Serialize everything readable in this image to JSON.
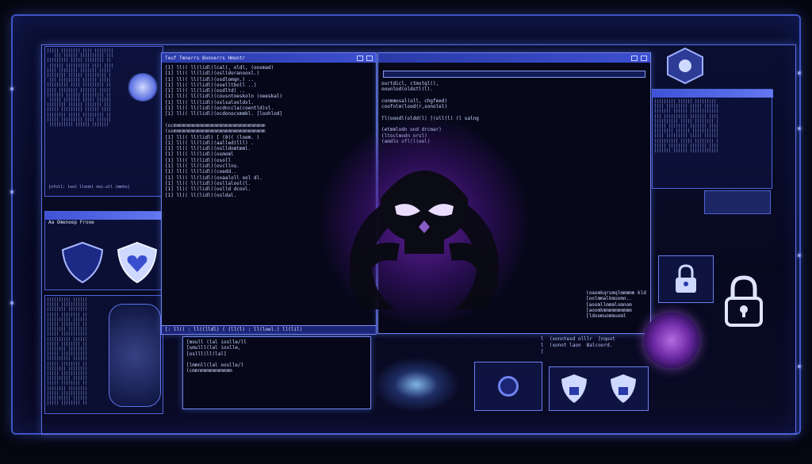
{
  "colors": {
    "accent": "#5a70e0",
    "glow_purple": "#a43bff",
    "panel": "#0b1033"
  },
  "main_terminal": {
    "title": "Teuf Tmnerrs Bonnerrs Hmontr",
    "lines": [
      "[1] ll(( ll(lidl)lcal(, oldl, (ooxmad)",
      "[1] ll(( ll(lidl)(oslldoranooxl.)",
      "[1] ll(( ll(lidl)(osdlomqn.) ..",
      "[1] ll(( ll(lidl)(oselltboll ..)",
      "[1] ll(( ll(lidl)(osdltd) ..",
      "[1] ll(( ll(lidl)(cousntoeskoln (oeeskal)",
      "[1] ll(( ll(lidl)(oxlsalooldxl.",
      "[1] ll(( ll(lidl)(ocdnccla(coentld)xl.",
      "[1] ll(( ll(lidl)(ocdonocsmmbl. [loohlod]",
      "",
      "(ocmmmmmmmmmmmmmmmmmmmmmmmmmmmmmmmm",
      "(sommmmmmmmmmmmmmmmmmmmmmmmmmmmmmmm",
      "[1] ll(( ll(lidl) [ (8(( (loem. )",
      "[1] ll(( ll(lidl)(aalled(lll) .",
      "[1] ll(( ll(lidl)(oslldomtmml.",
      "[1] ll(( ll(lidl)(osmoml",
      "[1] ll(( ll(lidl)(osoll",
      "[1] ll(( ll(lidl)(ovcllnu.",
      "[1] ll(( ll(lidl)(coedd..",
      "[1] ll(( ll(lidl)(oxaaloll ool dl.",
      "[1] ll(( ll(lidl)(osllalool(l.",
      "[1] ll(( ll(lidl)(oslld dcool.",
      "[1] ll(( ll(lidl)(osldal."
    ],
    "status": "[: ll(( : ll((lldl) ( (ll(l) : ll(loel.) ll(lil)"
  },
  "right_terminal": {
    "lines": [
      "ourtdicl, ctmstql(),",
      "oounlod(oldstl(l).",
      "",
      "conmmosal(oll, chgfeed)",
      "coofnlm(lood(r,sonolel)",
      "",
      "Tl(ooodl(oldd(l) [(oll(l) (l salng",
      "",
      "(etmmlodn ond drcmar)",
      "(ltoclmodn orsl)",
      "(amdlo ofl(l(eel)"
    ],
    "bottom_lines": [
      "(oaomkqrumqlmmmmm kld",
      "[oolmmalkmoomn..",
      "[aoomllmmmlomnom",
      "[aoomkmmmmmmmmmm",
      "[ldoomuommuoml"
    ]
  },
  "bottom_terminal": {
    "lines": [
      "[moull (lal ioslle/ll",
      "[smulll(lal ioslle,",
      "[oslll(ll(lal]",
      "",
      "[lmmnll(lal ooslle/l",
      "(cmmnmmmmmmmmmmm"
    ]
  },
  "left_panel": {
    "header": "Aa  Omenoep Frooe",
    "log": "[nfoll:  lool llonkl onc.oll  (mmhs]"
  },
  "right_log": {
    "lines": [
      "l  (xonntesd olllr  [nqoxt",
      "l  (xonnt laon  Balcoord.",
      "["
    ]
  },
  "icons": [
    "shield-icon",
    "shield-heart-icon",
    "padlock-icon",
    "biohazard-skull-icon",
    "shield-lock-icon"
  ]
}
